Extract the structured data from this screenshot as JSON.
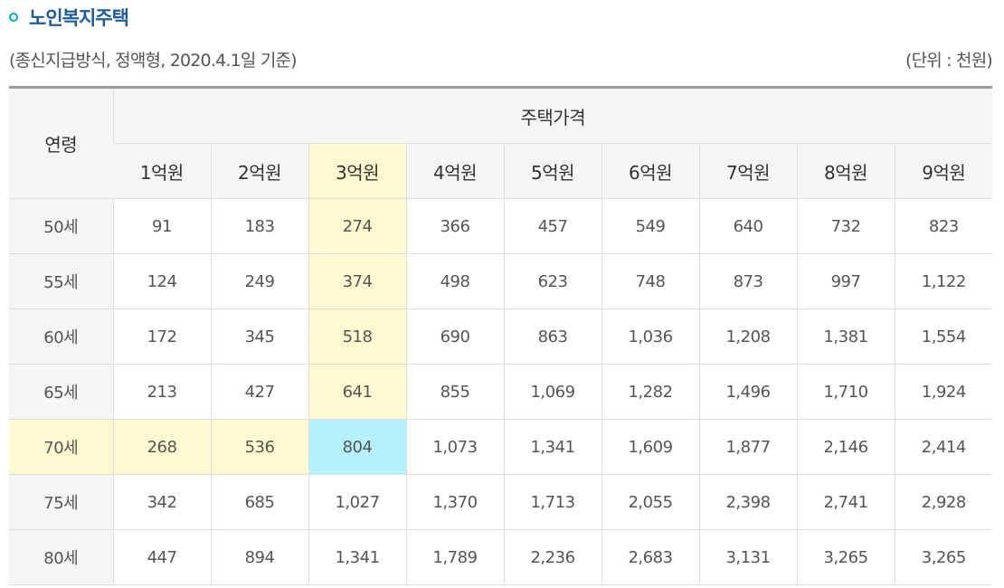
{
  "title": "노인복지주택",
  "condition": "(종신지급방식, 정액형, 2020.4.1일 기준)",
  "unit": "(단위 : 천원)",
  "table": {
    "age_header": "연령",
    "price_header": "주택가격",
    "price_columns": [
      "1억원",
      "2억원",
      "3억원",
      "4억원",
      "5억원",
      "6억원",
      "7억원",
      "8억원",
      "9억원"
    ],
    "rows": [
      {
        "age": "50세",
        "values": [
          "91",
          "183",
          "274",
          "366",
          "457",
          "549",
          "640",
          "732",
          "823"
        ]
      },
      {
        "age": "55세",
        "values": [
          "124",
          "249",
          "374",
          "498",
          "623",
          "748",
          "873",
          "997",
          "1,122"
        ]
      },
      {
        "age": "60세",
        "values": [
          "172",
          "345",
          "518",
          "690",
          "863",
          "1,036",
          "1,208",
          "1,381",
          "1,554"
        ]
      },
      {
        "age": "65세",
        "values": [
          "213",
          "427",
          "641",
          "855",
          "1,069",
          "1,282",
          "1,496",
          "1,710",
          "1,924"
        ]
      },
      {
        "age": "70세",
        "values": [
          "268",
          "536",
          "804",
          "1,073",
          "1,341",
          "1,609",
          "1,877",
          "2,146",
          "2,414"
        ]
      },
      {
        "age": "75세",
        "values": [
          "342",
          "685",
          "1,027",
          "1,370",
          "1,713",
          "2,055",
          "2,398",
          "2,741",
          "2,928"
        ]
      },
      {
        "age": "80세",
        "values": [
          "447",
          "894",
          "1,341",
          "1,789",
          "2,236",
          "2,683",
          "3,131",
          "3,265",
          "3,265"
        ]
      }
    ],
    "highlight": {
      "column_label": "3억원",
      "row_label": "70세",
      "cell_color": "#b4f1fa",
      "line_color": "#fff9d1"
    }
  }
}
